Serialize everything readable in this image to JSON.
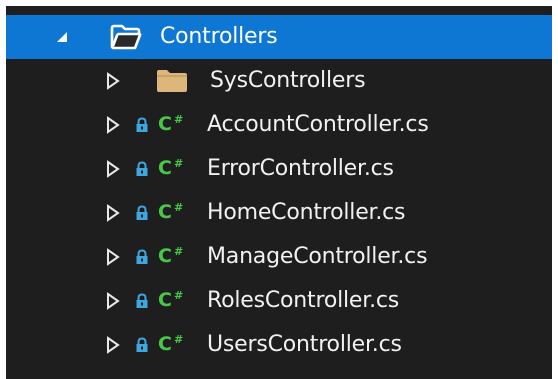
{
  "tree": {
    "root": {
      "label": "Controllers",
      "icon": "open-folder-icon",
      "expanded": true,
      "selected": true
    },
    "children": [
      {
        "label": "SysControllers",
        "icon": "folder-icon",
        "kind": "folder"
      },
      {
        "label": "AccountController.cs",
        "icon": "csharp-file-icon",
        "kind": "file",
        "badge": "lock-icon",
        "lang": "C#"
      },
      {
        "label": "ErrorController.cs",
        "icon": "csharp-file-icon",
        "kind": "file",
        "badge": "lock-icon",
        "lang": "C#"
      },
      {
        "label": "HomeController.cs",
        "icon": "csharp-file-icon",
        "kind": "file",
        "badge": "lock-icon",
        "lang": "C#"
      },
      {
        "label": "ManageController.cs",
        "icon": "csharp-file-icon",
        "kind": "file",
        "badge": "lock-icon",
        "lang": "C#"
      },
      {
        "label": "RolesController.cs",
        "icon": "csharp-file-icon",
        "kind": "file",
        "badge": "lock-icon",
        "lang": "C#"
      },
      {
        "label": "UsersController.cs",
        "icon": "csharp-file-icon",
        "kind": "file",
        "badge": "lock-icon",
        "lang": "C#"
      }
    ]
  },
  "colors": {
    "background": "#1e1e1e",
    "selection": "#0e77d4",
    "text": "#f1f1f1",
    "folder": "#dcb67a",
    "csharp": "#48c946",
    "lock": "#3ea7e0"
  }
}
